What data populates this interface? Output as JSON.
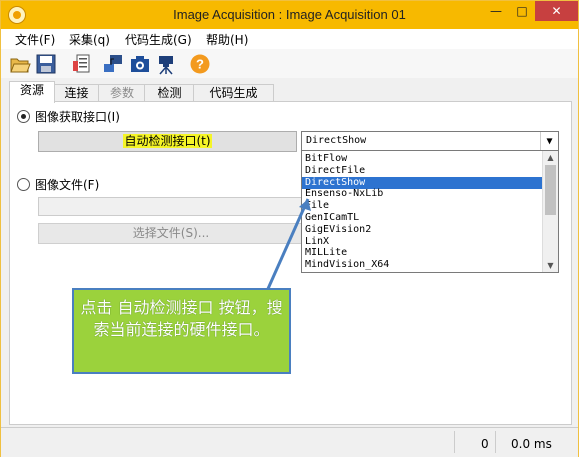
{
  "window": {
    "title": "Image Acquisition : Image Acquisition 01"
  },
  "menu": [
    "文件(F)",
    "采集(q)",
    "代码生成(G)",
    "帮助(H)"
  ],
  "toolbar": {
    "icons": [
      "open-folder-icon",
      "save-icon",
      "properties-icon",
      "connect-icon",
      "snap-icon",
      "live-camera-icon",
      "help-icon"
    ]
  },
  "tabs": [
    {
      "label": "资源",
      "active": true
    },
    {
      "label": "连接"
    },
    {
      "label": "参数",
      "disabled": true
    },
    {
      "label": "检测"
    },
    {
      "label": "代码生成"
    }
  ],
  "panel": {
    "radio_interface": "图像获取接口(I)",
    "auto_detect_button": "自动检测接口(t)",
    "combo_value": "DirectShow",
    "radio_file": "图像文件(F)",
    "choose_file_button": "选择文件(S)..."
  },
  "dropdown": {
    "options": [
      "BitFlow",
      "DirectFile",
      "DirectShow",
      "Ensenso-NxLib",
      "File",
      "GenICamTL",
      "GigEVision2",
      "LinX",
      "MILLite",
      "MindVision_X64"
    ],
    "selected_index": 2
  },
  "callout": {
    "text": "点击 自动检测接口 按钮，搜索当前连接的硬件接口。"
  },
  "status": {
    "count": "0",
    "time": "0.0 ms"
  },
  "colors": {
    "title_bar": "#f7b900",
    "callout_fill": "#9bd23c",
    "callout_border": "#4a7fc0",
    "selection": "#2d73d0",
    "highlight": "#f5f527"
  }
}
